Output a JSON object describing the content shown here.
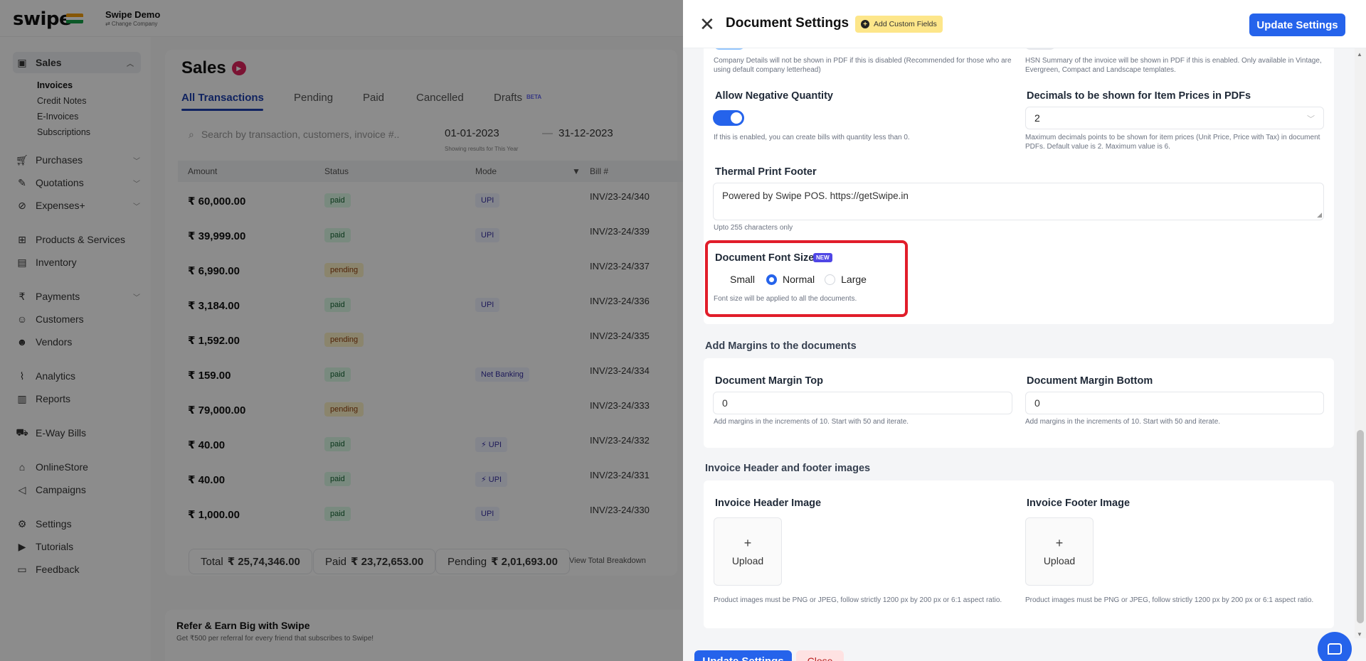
{
  "app": {
    "logo": "swipe",
    "company_name": "Swipe Demo",
    "company_sub": "⇄ Change Company"
  },
  "sidebar": {
    "items": [
      {
        "label": "Sales",
        "icon": "sales-icon"
      },
      {
        "label": "Purchases",
        "icon": "cart-icon"
      },
      {
        "label": "Quotations",
        "icon": "pen-icon"
      },
      {
        "label": "Expenses+",
        "icon": "tag-icon"
      },
      {
        "label": "Products & Services",
        "icon": "box-icon"
      },
      {
        "label": "Inventory",
        "icon": "inventory-icon"
      },
      {
        "label": "Payments",
        "icon": "rupee-icon"
      },
      {
        "label": "Customers",
        "icon": "user-icon"
      },
      {
        "label": "Vendors",
        "icon": "users-icon"
      },
      {
        "label": "Analytics",
        "icon": "chart-icon"
      },
      {
        "label": "Reports",
        "icon": "report-icon"
      },
      {
        "label": "E-Way Bills",
        "icon": "truck-icon"
      },
      {
        "label": "OnlineStore",
        "icon": "store-icon"
      },
      {
        "label": "Campaigns",
        "icon": "megaphone-icon"
      },
      {
        "label": "Settings",
        "icon": "gear-icon"
      },
      {
        "label": "Tutorials",
        "icon": "video-icon"
      },
      {
        "label": "Feedback",
        "icon": "chat-icon"
      }
    ],
    "sales_sub": [
      "Invoices",
      "Credit Notes",
      "E-Invoices",
      "Subscriptions"
    ]
  },
  "sales": {
    "title": "Sales",
    "tabs": [
      "All Transactions",
      "Pending",
      "Paid",
      "Cancelled",
      "Drafts"
    ],
    "beta": "BETA",
    "search_placeholder": "Search by transaction, customers, invoice #..",
    "date_from": "01-01-2023",
    "date_sep": "—",
    "date_to": "31-12-2023",
    "date_sub": "Showing results for This Year",
    "columns": [
      "Amount",
      "Status",
      "Mode",
      "Bill #"
    ],
    "rows": [
      {
        "amount": "₹ 60,000.00",
        "status": "paid",
        "mode": "UPI",
        "bill": "INV/23-24/340"
      },
      {
        "amount": "₹ 39,999.00",
        "status": "paid",
        "mode": "UPI",
        "bill": "INV/23-24/339"
      },
      {
        "amount": "₹ 6,990.00",
        "status": "pending",
        "mode": "",
        "bill": "INV/23-24/337"
      },
      {
        "amount": "₹ 3,184.00",
        "status": "paid",
        "mode": "UPI",
        "bill": "INV/23-24/336"
      },
      {
        "amount": "₹ 1,592.00",
        "status": "pending",
        "mode": "",
        "bill": "INV/23-24/335"
      },
      {
        "amount": "₹ 159.00",
        "status": "paid",
        "mode": "Net Banking",
        "bill": "INV/23-24/334"
      },
      {
        "amount": "₹ 79,000.00",
        "status": "pending",
        "mode": "",
        "bill": "INV/23-24/333"
      },
      {
        "amount": "₹ 40.00",
        "status": "paid",
        "mode": "⚡ UPI",
        "bill": "INV/23-24/332"
      },
      {
        "amount": "₹ 40.00",
        "status": "paid",
        "mode": "⚡ UPI",
        "bill": "INV/23-24/331"
      },
      {
        "amount": "₹ 1,000.00",
        "status": "paid",
        "mode": "UPI",
        "bill": "INV/23-24/330"
      }
    ],
    "total_label": "Total",
    "total_value": "₹ 25,74,346.00",
    "paid_label": "Paid",
    "paid_value": "₹ 23,72,653.00",
    "pending_label": "Pending",
    "pending_value": "₹ 2,01,693.00",
    "view_breakdown": "View Total Breakdown",
    "refer_title": "Refer & Earn Big with Swipe",
    "refer_sub": "Get ₹500 per referral for every friend that subscribes to Swipe!"
  },
  "drawer": {
    "title": "Document Settings",
    "add_custom_fields": "Add Custom Fields",
    "update_button": "Update Settings",
    "close_button": "Close",
    "company_details_hint": "Company Details will not be shown in PDF if this is disabled (Recommended for those who are using default company letterhead)",
    "hsn_hint": "HSN Summary of the invoice will be shown in PDF if this is enabled. Only available in Vintage, Evergreen, Compact and Landscape templates.",
    "allow_negative_label": "Allow Negative Quantity",
    "allow_negative_hint": "If this is enabled, you can create bills with quantity less than 0.",
    "decimals_label": "Decimals to be shown for Item Prices in PDFs",
    "decimals_value": "2",
    "decimals_hint": "Maximum decimals points to be shown for item prices (Unit Price, Price with Tax) in document PDFs. Default value is 2. Maximum value is 6.",
    "thermal_label": "Thermal Print Footer",
    "thermal_value": "Powered by Swipe POS. https://getSwipe.in",
    "thermal_hint": "Upto 255 characters only",
    "font_size_label": "Document Font Size",
    "new_badge": "NEW",
    "font_options": [
      "Small",
      "Normal",
      "Large"
    ],
    "font_selected": "Normal",
    "font_hint": "Font size will be applied to all the documents.",
    "margins_section": "Add Margins to the documents",
    "margin_top_label": "Document Margin Top",
    "margin_top_value": "0",
    "margin_bottom_label": "Document Margin Bottom",
    "margin_bottom_value": "0",
    "margin_hint": "Add margins in the increments of 10. Start with 50 and iterate.",
    "images_section": "Invoice Header and footer images",
    "header_image_label": "Invoice Header Image",
    "footer_image_label": "Invoice Footer Image",
    "upload_plus": "+",
    "upload_label": "Upload",
    "image_hint": "Product images must be PNG or JPEG, follow strictly 1200 px by 200 px or 6:1 aspect ratio."
  }
}
